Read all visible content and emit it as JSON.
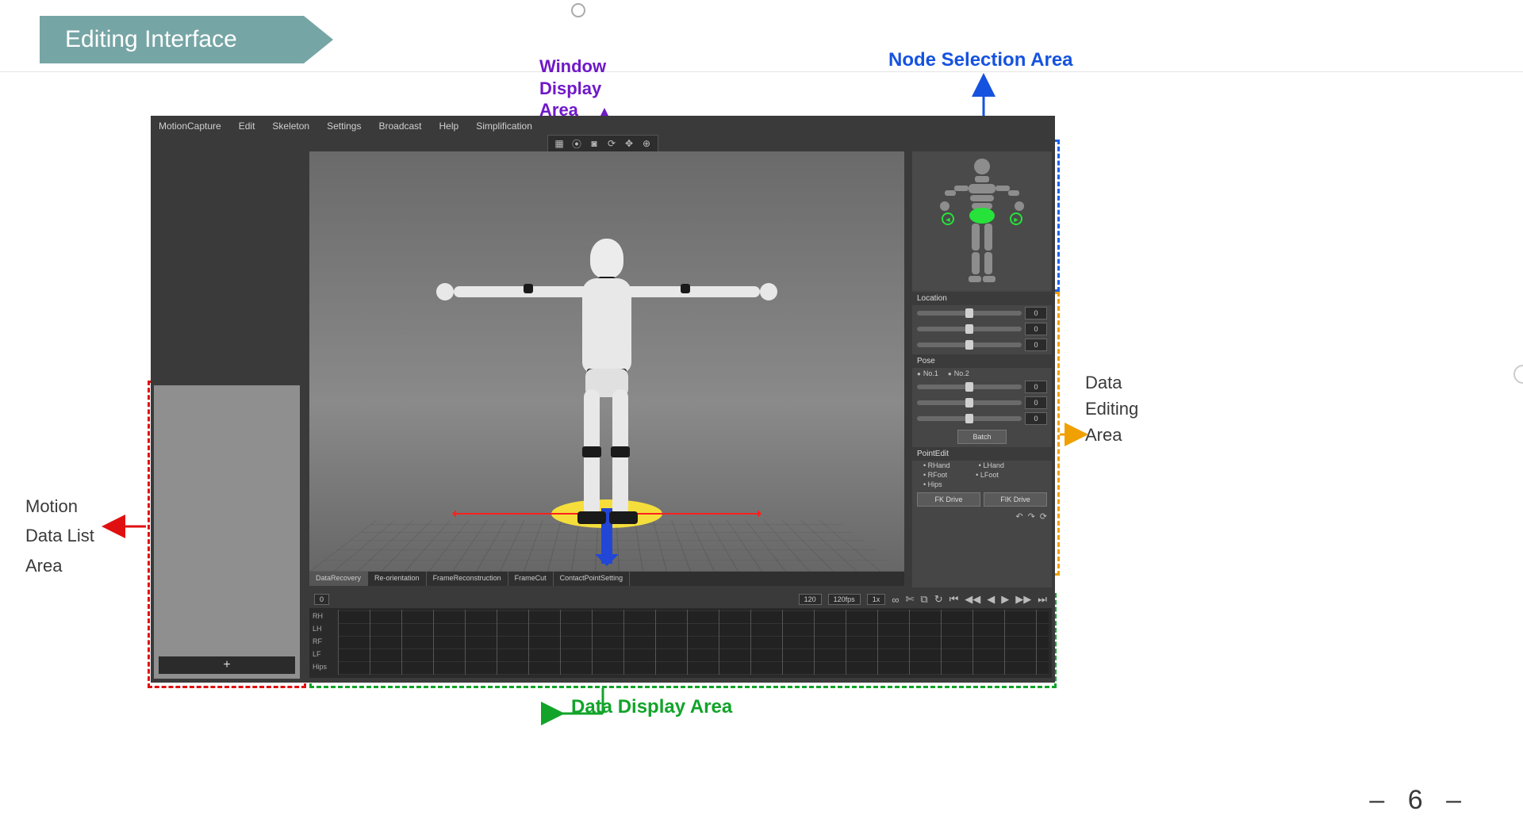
{
  "slide": {
    "title": "Editing Interface",
    "page_number": "– 6 –"
  },
  "menubar": {
    "items": [
      "MotionCapture",
      "Edit",
      "Skeleton",
      "Settings",
      "Broadcast",
      "Help",
      "Simplification"
    ]
  },
  "viewport_toolbar": {
    "icons": [
      "grid-icon",
      "record-icon",
      "camera-icon",
      "refresh-icon",
      "move-icon",
      "target-icon"
    ]
  },
  "data_list": {
    "add_label": "+"
  },
  "bottom_tabs": {
    "items": [
      "DataRecovery",
      "Re-orientation",
      "FrameReconstruction",
      "FrameCut",
      "ContactPointSetting"
    ]
  },
  "timeline": {
    "track_labels": [
      "RH",
      "LH",
      "RF",
      "LF",
      "Hips"
    ],
    "left_box": "0",
    "fps_box": "120fps",
    "speed_box": "1x",
    "frame_total": "120",
    "transport_icons": [
      "loop-icon",
      "rewind-start-icon",
      "step-back-icon",
      "play-back-icon",
      "play-icon",
      "step-forward-icon",
      "forward-end-icon"
    ],
    "extra_icons": [
      "link-icon",
      "cut-icon",
      "copy-icon"
    ]
  },
  "right_panel": {
    "loc_header": "Location",
    "loc_values": [
      "0",
      "0",
      "0"
    ],
    "pose_header": "Pose",
    "pose_options": [
      "No.1",
      "No.2"
    ],
    "pose_values": [
      "0",
      "0",
      "0"
    ],
    "batch_label": "Batch",
    "pointedit_header": "PointEdit",
    "pointedit_items": [
      "RHand",
      "LHand",
      "RFoot",
      "LFoot",
      "Hips"
    ],
    "drive_buttons": [
      "FK Drive",
      "FIK Drive"
    ],
    "tiny_icons": [
      "undo-icon",
      "redo-icon",
      "sync-icon"
    ]
  },
  "node_figure": {
    "arrow_glyph_left": "◄",
    "arrow_glyph_right": "►"
  },
  "annotations": {
    "window_display": "Window\nDisplay\nArea",
    "node_selection": "Node Selection Area",
    "data_editing": "Data\nEditing\nArea",
    "motion_list": "Motion\nData List\nArea",
    "data_display": "Data Display Area"
  }
}
